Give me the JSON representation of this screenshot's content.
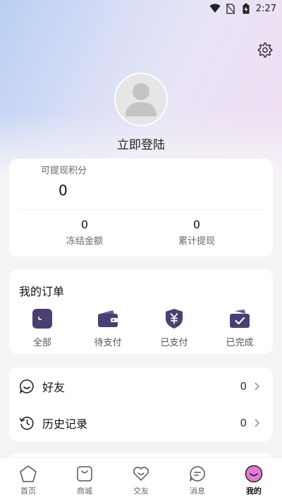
{
  "status_bar": {
    "time": "2:27"
  },
  "profile": {
    "login_label": "立即登陆"
  },
  "points": {
    "label": "可提现积分",
    "value": "0",
    "frozen": {
      "value": "0",
      "label": "冻结金额"
    },
    "withdrawn": {
      "value": "0",
      "label": "累计提现"
    }
  },
  "orders": {
    "title": "我的订单",
    "items": [
      {
        "label": "全部",
        "icon": "all-orders-icon"
      },
      {
        "label": "待支付",
        "icon": "wallet-icon"
      },
      {
        "label": "已支付",
        "icon": "yuan-shield-icon"
      },
      {
        "label": "已完成",
        "icon": "check-box-icon"
      }
    ]
  },
  "list": [
    {
      "label": "好友",
      "count": "0",
      "icon": "smile-chat-icon"
    },
    {
      "label": "历史记录",
      "count": "0",
      "icon": "history-icon"
    }
  ],
  "tabs": [
    {
      "label": "首页",
      "icon": "home-icon"
    },
    {
      "label": "商城",
      "icon": "shop-bag-icon"
    },
    {
      "label": "交友",
      "icon": "heart-icon"
    },
    {
      "label": "消息",
      "icon": "message-icon"
    },
    {
      "label": "我的",
      "icon": "profile-smile-icon",
      "active": true
    }
  ],
  "colors": {
    "accent": "#4b3f72",
    "active_tab": "#e27ad9"
  }
}
